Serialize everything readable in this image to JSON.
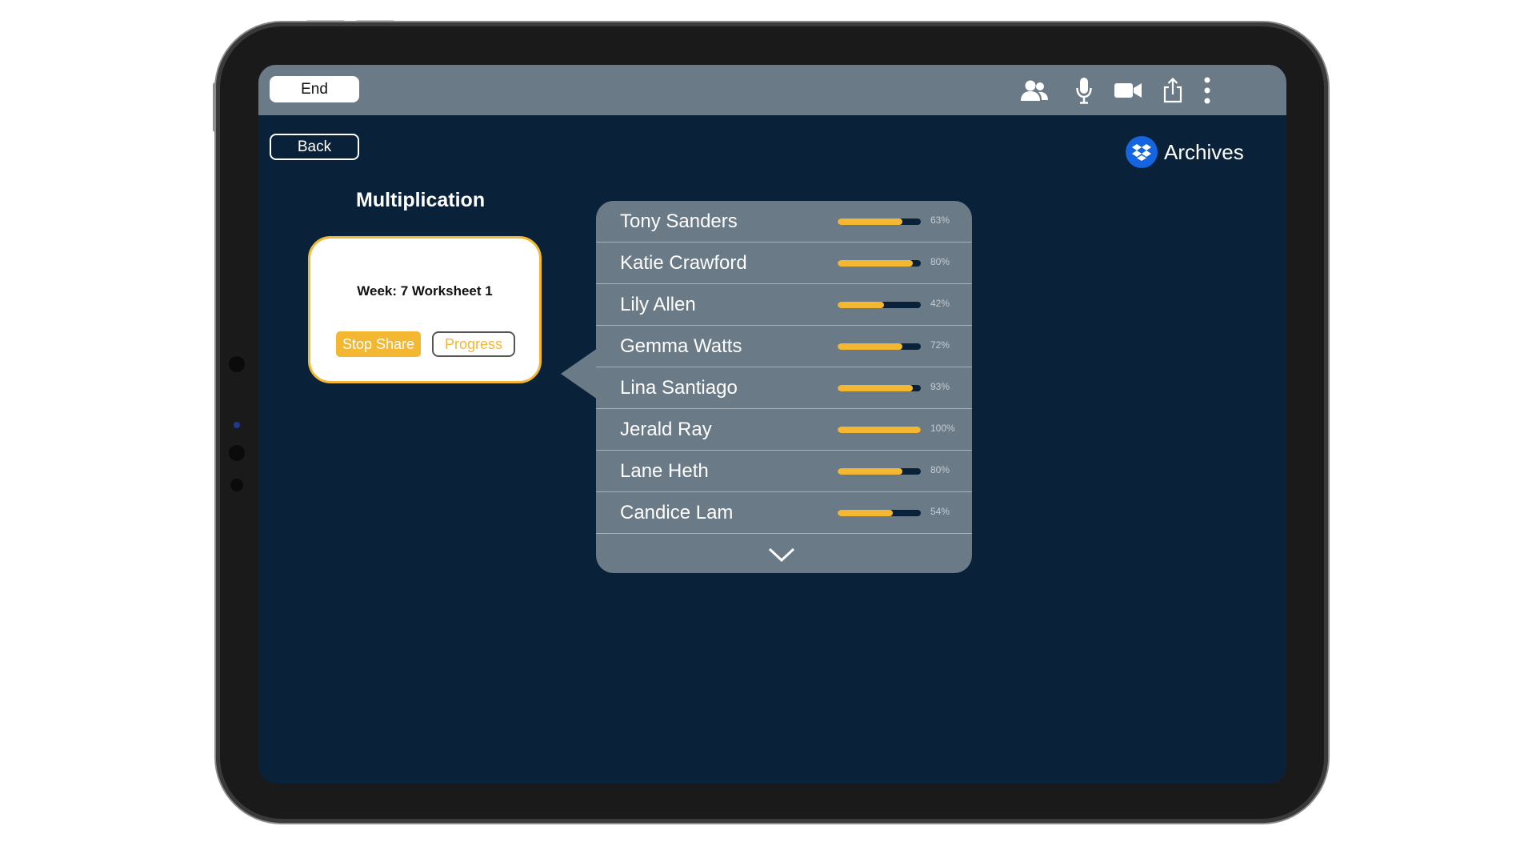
{
  "topbar": {
    "end_label": "End",
    "icons": [
      "users-icon",
      "microphone-icon",
      "video-camera-icon",
      "share-icon",
      "more-vertical-icon"
    ]
  },
  "nav": {
    "back_label": "Back"
  },
  "archives": {
    "label": "Archives",
    "icon": "dropbox-icon",
    "brand_color": "#1565e0"
  },
  "page": {
    "title": "Multiplication"
  },
  "worksheet_card": {
    "title": "Week: 7 Worksheet 1",
    "stop_share_label": "Stop Share",
    "progress_label": "Progress"
  },
  "students": [
    {
      "name": "Tony Sanders",
      "progress": 0.78,
      "percent_label": "63%"
    },
    {
      "name": "Katie Crawford",
      "progress": 0.9,
      "percent_label": "80%"
    },
    {
      "name": "Lily Allen",
      "progress": 0.56,
      "percent_label": "42%"
    },
    {
      "name": "Gemma Watts",
      "progress": 0.78,
      "percent_label": "72%"
    },
    {
      "name": "Lina Santiago",
      "progress": 0.9,
      "percent_label": "93%"
    },
    {
      "name": "Jerald Ray",
      "progress": 1.0,
      "percent_label": "100%"
    },
    {
      "name": "Lane Heth",
      "progress": 0.78,
      "percent_label": "80%"
    },
    {
      "name": "Candice Lam",
      "progress": 0.66,
      "percent_label": "54%"
    }
  ],
  "colors": {
    "background": "#0a2239",
    "topbar": "#6b7a87",
    "accent": "#f4b731",
    "panel": "#6b7a87"
  }
}
